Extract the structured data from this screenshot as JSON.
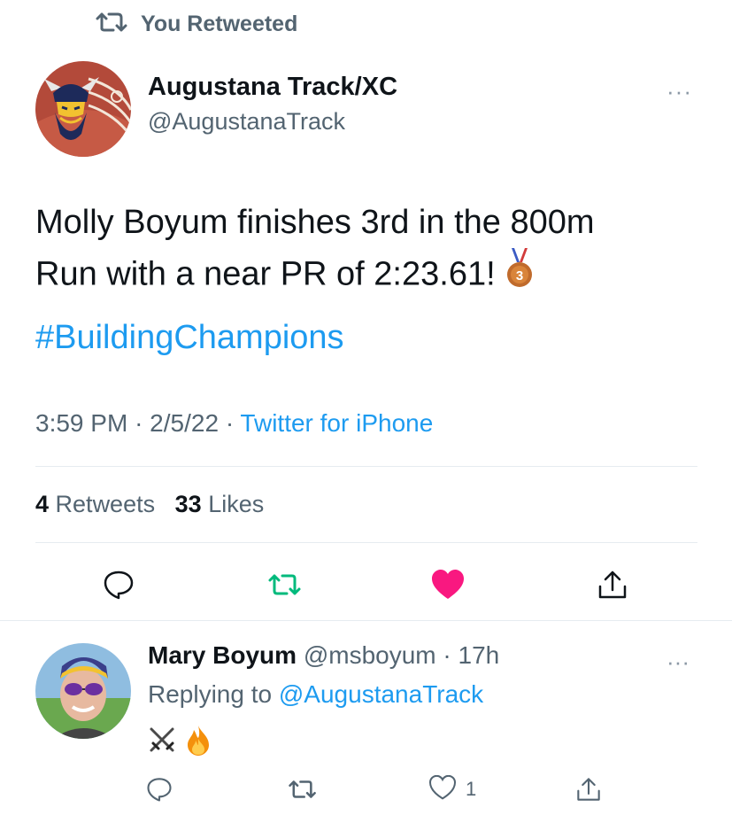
{
  "retweet_banner": {
    "icon": "retweet-icon",
    "text": "You Retweeted"
  },
  "tweet": {
    "author_name": "Augustana Track/XC",
    "author_handle": "@AugustanaTrack",
    "more": "···",
    "text_line1": "Molly Boyum finishes 3rd in the 800m",
    "text_line2": "Run with a near PR of 2:23.61!",
    "medal_icon": "third-place-medal-icon",
    "hashtag": "#BuildingChampions",
    "time": "3:59 PM",
    "date": "2/5/22",
    "source": "Twitter for iPhone",
    "retweets_count": "4",
    "retweets_label": "Retweets",
    "likes_count": "33",
    "likes_label": "Likes",
    "actions": [
      "reply-icon",
      "retweet-icon",
      "like-icon",
      "share-icon"
    ],
    "colors": {
      "retweeted": "#00ba7c",
      "liked": "#f91880",
      "link": "#1d9bf0",
      "muted": "#536471"
    }
  },
  "reply": {
    "author_name": "Mary Boyum",
    "author_handle": "@msboyum",
    "time_ago": "17h",
    "replying_to_label": "Replying to",
    "replying_to_handle": "@AugustanaTrack",
    "emojis": [
      "crossed-swords-icon",
      "fire-icon"
    ],
    "more": "···",
    "like_count": "1"
  }
}
